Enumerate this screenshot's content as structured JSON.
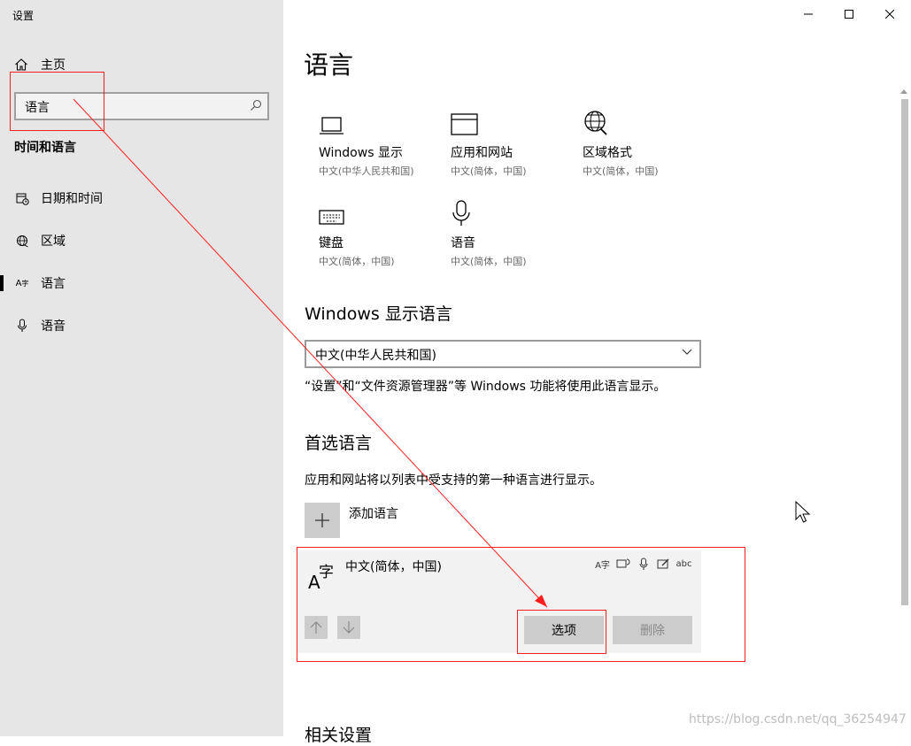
{
  "window": {
    "title": "设置"
  },
  "sidebar": {
    "home_label": "主页",
    "search": {
      "value": "语言"
    },
    "section_title": "时间和语言",
    "items": [
      {
        "label": "日期和时间",
        "icon": "calendar-clock-icon",
        "active": false
      },
      {
        "label": "区域",
        "icon": "globe-icon",
        "active": false
      },
      {
        "label": "语言",
        "icon": "language-icon",
        "active": true
      },
      {
        "label": "语音",
        "icon": "microphone-icon",
        "active": false
      }
    ]
  },
  "main": {
    "title": "语言",
    "tiles": [
      {
        "label": "Windows 显示",
        "sub": "中文(中华人民共和国)",
        "icon": "laptop-icon"
      },
      {
        "label": "应用和网站",
        "sub": "中文(简体，中国)",
        "icon": "window-icon"
      },
      {
        "label": "区域格式",
        "sub": "中文(简体，中国)",
        "icon": "globe-settings-icon"
      },
      {
        "label": "键盘",
        "sub": "中文(简体，中国)",
        "icon": "keyboard-icon"
      },
      {
        "label": "语音",
        "sub": "中文(简体，中国)",
        "icon": "microphone-icon"
      }
    ],
    "display_language": {
      "heading": "Windows 显示语言",
      "selected": "中文(中华人民共和国)",
      "description": "“设置”和“文件资源管理器”等 Windows 功能将使用此语言显示。"
    },
    "preferred": {
      "heading": "首选语言",
      "description": "应用和网站将以列表中受支持的第一种语言进行显示。",
      "add_label": "添加语言",
      "languages": [
        {
          "name": "中文(简体，中国)",
          "glyph_latin": "A",
          "glyph_cjk": "字",
          "features": [
            "display-language-icon",
            "speech-icon",
            "voice-recognition-icon",
            "handwriting-icon",
            "spelling-icon"
          ],
          "options_label": "选项",
          "remove_label": "删除"
        }
      ]
    },
    "related_heading": "相关设置"
  },
  "watermark": "https://blog.csdn.net/qq_36254947",
  "colors": {
    "sidebar_bg": "#e6e6e6",
    "card_bg": "#f2f2f2",
    "button_bg": "#cccccc",
    "annotation_red": "#ff1e1e"
  }
}
